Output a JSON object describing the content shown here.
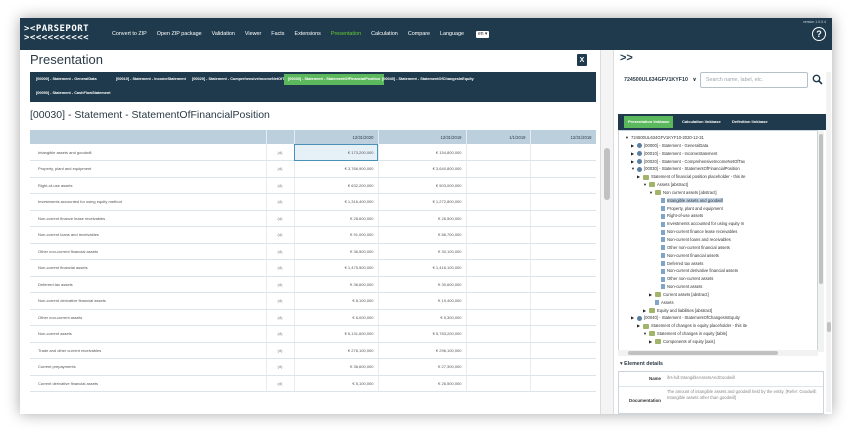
{
  "navbar": {
    "logo_line1": "><PARSEPORT",
    "logo_line2": "><<<<<<<<<<",
    "items": [
      "Convert to ZIP",
      "Open ZIP package",
      "Validation",
      "Viewer",
      "Facts",
      "Extensions",
      "Presentation",
      "Calculation",
      "Compare",
      "Language"
    ],
    "active_item": "Presentation",
    "language_value": "en",
    "version": "version 1.0.0.4",
    "help_glyph": "?"
  },
  "main": {
    "title": "Presentation",
    "excel_glyph": "X",
    "tabs_row1": [
      "[00000] - Statement - GeneralData",
      "[00010] - Statement - IncomeStatement",
      "[00020] - Statement - ComprehensiveIncomeNetOfTax",
      "[00030] - Statement - StatementOfFinancialPosition",
      "[00040] - Statement - StatementOfChangesInEquity"
    ],
    "tabs_row2": [
      "[00050] - Statement - CashFlowStatement"
    ],
    "active_tab": "[00030] - Statement - StatementOfFinancialPosition",
    "section_title": "[00030] - Statement - StatementOfFinancialPosition",
    "table": {
      "columns": [
        "",
        "",
        "12/31/2020",
        "12/31/2019",
        "1/1/2019",
        "12/31/2018"
      ],
      "rows": [
        {
          "label": "Intangible assets and goodwill",
          "period": "(d)",
          "v2020": "€ 173,200,000",
          "v2019": "€ 154,800,000",
          "selected": true
        },
        {
          "label": "Property, plant and equipment",
          "period": "(d)",
          "v2020": "€ 3,766,900,000",
          "v2019": "€ 3,640,800,000"
        },
        {
          "label": "Right-of-use assets",
          "period": "(d)",
          "v2020": "€ 632,200,000",
          "v2019": "€ 503,000,000"
        },
        {
          "label": "Investments accounted for using equity method",
          "period": "(d)",
          "v2020": "€ 1,316,400,000",
          "v2019": "€ 1,272,800,000"
        },
        {
          "label": "Non-current finance lease receivables",
          "period": "(d)",
          "v2020": "€ 28,600,000",
          "v2019": "€ 26,500,000"
        },
        {
          "label": "Non-current loans and receivables",
          "period": "(d)",
          "v2020": "€ 91,000,000",
          "v2019": "€ 86,700,000"
        },
        {
          "label": "Other non-current financial assets",
          "period": "(d)",
          "v2020": "€ 36,500,000",
          "v2019": "€ 30,100,000"
        },
        {
          "label": "Non-current financial assets",
          "period": "(d)",
          "v2020": "€ 1,475,500,000",
          "v2019": "€ 1,416,100,000"
        },
        {
          "label": "Deferred tax assets",
          "period": "(d)",
          "v2020": "€ 36,600,000",
          "v2019": "€ 30,600,000"
        },
        {
          "label": "Non-current derivative financial assets",
          "period": "(d)",
          "v2020": "€ 8,100,000",
          "v2019": "€ 19,400,000"
        },
        {
          "label": "Other non-current assets",
          "period": "(d)",
          "v2020": "€ 6,000,000",
          "v2019": "€ 5,300,000"
        },
        {
          "label": "Non-current assets",
          "period": "(d)",
          "v2020": "€ 6,131,600,000",
          "v2019": "€ 5,783,200,000"
        },
        {
          "label": "Trade and other current receivables",
          "period": "(d)",
          "v2020": "€ 276,100,000",
          "v2019": "€ 296,100,000"
        },
        {
          "label": "Current prepayments",
          "period": "(d)",
          "v2020": "€ 36,600,000",
          "v2019": "€ 27,300,000"
        },
        {
          "label": "Current derivative financial assets",
          "period": "(d)",
          "v2020": "€ 5,100,000",
          "v2019": "€ 26,500,000"
        }
      ]
    }
  },
  "right": {
    "collapse_glyph": ">>",
    "entity": "724500UL634GFV1KYF10",
    "entity_caret": "∨",
    "search_placeholder": "Search name, label, etc.",
    "linkbase_tabs": [
      "Presentation linkbase",
      "Calculation linkbase",
      "Definition linkbase"
    ],
    "active_linkbase": "Presentation linkbase",
    "tree": [
      {
        "level": 0,
        "arrow": "▼",
        "icon": "none",
        "text": "724500UL634GFV1KYF10-2020-12-31"
      },
      {
        "level": 1,
        "arrow": "▶",
        "icon": "gear",
        "text": "[00000] - Statement - GeneralData"
      },
      {
        "level": 1,
        "arrow": "▶",
        "icon": "gear",
        "text": "[00010] - Statement - IncomeStatement"
      },
      {
        "level": 1,
        "arrow": "▶",
        "icon": "gear",
        "text": "[00020] - Statement - ComprehensiveIncomeNetOfTax"
      },
      {
        "level": 1,
        "arrow": "▼",
        "icon": "gear",
        "text": "[00030] - Statement - StatementOfFinancialPosition"
      },
      {
        "level": 2,
        "arrow": "▶",
        "icon": "fx",
        "text": "Statement of financial position placeholder - this ite"
      },
      {
        "level": 3,
        "arrow": "▼",
        "icon": "fx",
        "text": "Assets [abstract]"
      },
      {
        "level": 4,
        "arrow": "▼",
        "icon": "fx",
        "text": "Non current assets [abstract]"
      },
      {
        "level": 5,
        "arrow": "",
        "icon": "doc",
        "text": "Intangible assets and goodwill",
        "selected": true
      },
      {
        "level": 5,
        "arrow": "",
        "icon": "doc",
        "text": "Property, plant and equipment"
      },
      {
        "level": 5,
        "arrow": "",
        "icon": "doc",
        "text": "Right-of-use assets"
      },
      {
        "level": 5,
        "arrow": "",
        "icon": "doc",
        "text": "Investments accounted for using equity m"
      },
      {
        "level": 5,
        "arrow": "",
        "icon": "doc",
        "text": "Non-current finance lease receivables"
      },
      {
        "level": 5,
        "arrow": "",
        "icon": "doc",
        "text": "Non-current loans and receivables"
      },
      {
        "level": 5,
        "arrow": "",
        "icon": "doc",
        "text": "Other non-current financial assets"
      },
      {
        "level": 5,
        "arrow": "",
        "icon": "doc",
        "text": "Non-current financial assets"
      },
      {
        "level": 5,
        "arrow": "",
        "icon": "doc",
        "text": "Deferred tax assets"
      },
      {
        "level": 5,
        "arrow": "",
        "icon": "doc",
        "text": "Non-current derivative financial assets"
      },
      {
        "level": 5,
        "arrow": "",
        "icon": "doc",
        "text": "Other non-current assets"
      },
      {
        "level": 5,
        "arrow": "",
        "icon": "doc",
        "text": "Non-current assets"
      },
      {
        "level": 4,
        "arrow": "▶",
        "icon": "fx",
        "text": "Current assets [abstract]"
      },
      {
        "level": 4,
        "arrow": "",
        "icon": "doc",
        "text": "Assets"
      },
      {
        "level": 3,
        "arrow": "▶",
        "icon": "fx",
        "text": "Equity and liabilities [abstract]"
      },
      {
        "level": 1,
        "arrow": "▶",
        "icon": "gear",
        "text": "[00040] - Statement - StatementOfChangesInEquity"
      },
      {
        "level": 2,
        "arrow": "▶",
        "icon": "fx",
        "text": "Statement of changes in equity placeholder - this ite"
      },
      {
        "level": 3,
        "arrow": "▼",
        "icon": "fx",
        "text": "Statement of changes in equity [table]"
      },
      {
        "level": 4,
        "arrow": "▶",
        "icon": "fx",
        "text": "Components of equity [axis]"
      }
    ],
    "details": {
      "heading": "Element details",
      "name_key": "Name",
      "name_value": "ifrs-full:IntangibleAssetsAndGoodwill",
      "doc_key": "Documentation",
      "doc_value": "The amount of intangible assets and goodwill held by the entity. [Refer: Goodwill; Intangible assets other than goodwill]"
    }
  },
  "colors": {
    "navbar": "#1e3a4c",
    "active": "#5cb85c",
    "table_header": "#bccfdc"
  }
}
